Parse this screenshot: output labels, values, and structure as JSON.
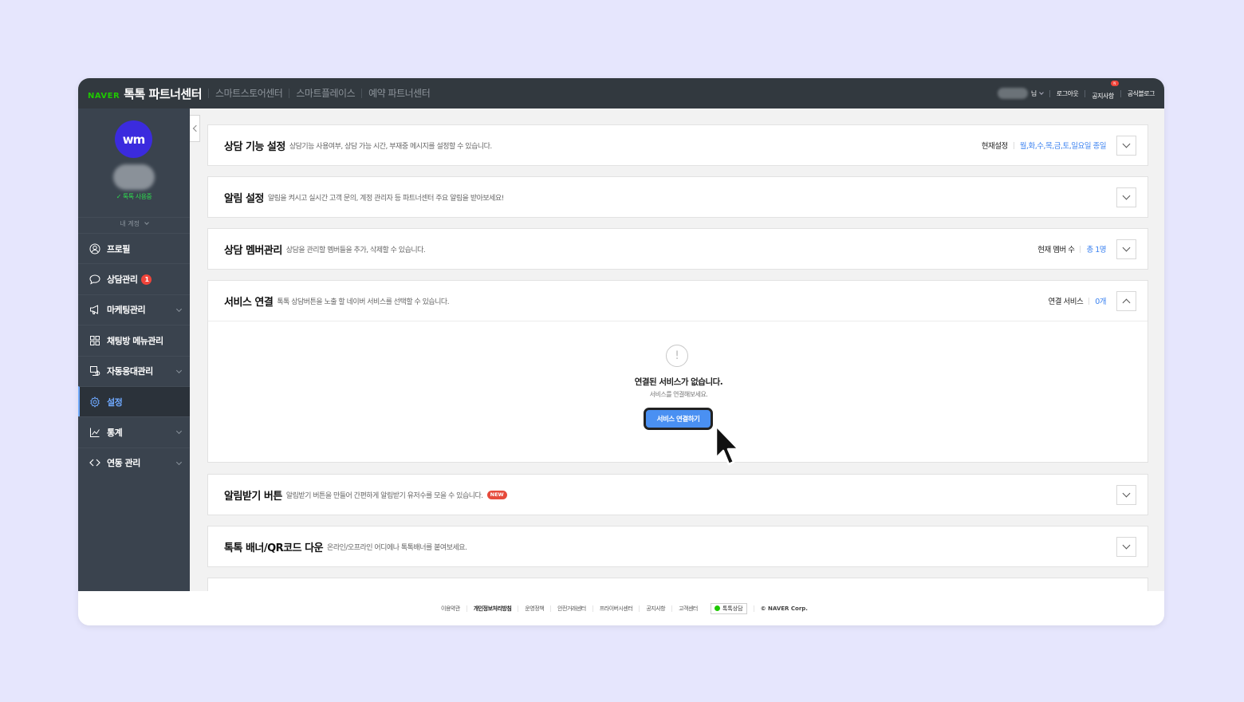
{
  "topbar": {
    "naver": "NAVER",
    "title": "톡톡 파트너센터",
    "nav": [
      "스마트스토어센터",
      "스마트플레이스",
      "예약 파트너센터"
    ],
    "user_suffix": "님",
    "logout": "로그아웃",
    "notice": "공지사항",
    "notice_badge": "N",
    "blog": "공식블로그"
  },
  "sidebar": {
    "avatar_text": "wm",
    "status": "톡톡 사용중",
    "account": "내 계정",
    "items": [
      {
        "label": "프로필",
        "icon": "profile-icon"
      },
      {
        "label": "상담관리",
        "icon": "chat-bubble-icon",
        "badge": "1"
      },
      {
        "label": "마케팅관리",
        "icon": "megaphone-icon"
      },
      {
        "label": "채팅방 메뉴관리",
        "icon": "grid-icon"
      },
      {
        "label": "자동응대관리",
        "icon": "auto-reply-icon"
      },
      {
        "label": "설정",
        "icon": "gear-icon"
      },
      {
        "label": "통계",
        "icon": "chart-icon"
      },
      {
        "label": "연동 관리",
        "icon": "code-icon"
      }
    ]
  },
  "cards": [
    {
      "title": "상담 기능 설정",
      "desc": "상담기능 사용여부, 상담 가능 시간, 부재중 메시지를 설정할 수 있습니다.",
      "right_label": "현재설정",
      "right_value": "월,화,수,목,금,토,일요일 종일"
    },
    {
      "title": "알림 설정",
      "desc": "알림을 켜시고 실시간 고객 문의, 계정 관리자 등 파트너센터 주요 알림을 받아보세요!"
    },
    {
      "title": "상담 멤버관리",
      "desc": "상담을 관리할 멤버들을 추가, 삭제할 수 있습니다.",
      "right_label": "현재 멤버 수",
      "right_value": "총 1명"
    },
    {
      "title": "서비스 연결",
      "desc": "톡톡 상담버튼을 노출 할 네이버 서비스를 선택할 수 있습니다.",
      "right_label": "연결 서비스",
      "right_value": "0개"
    },
    {
      "title": "알림받기 버튼",
      "desc": "알림받기 버튼을 만들어 간편하게 알림받기 유저수를 모을 수 있습니다.",
      "badge": "NEW"
    },
    {
      "title": "톡톡 배너/QR코드 다운",
      "desc": "온라인/오프라인 어디에나 톡톡배너를 붙여보세요."
    }
  ],
  "service_empty": {
    "icon": "!",
    "title": "연결된 서비스가 없습니다.",
    "desc": "서비스를 연결해보세요.",
    "button": "서비스 연결하기"
  },
  "footer": {
    "links": [
      "이용약관",
      "개인정보처리방침",
      "운영정책",
      "안전거래센터",
      "프라이버시센터",
      "공지사항",
      "고객센터"
    ],
    "talk": "톡톡상담",
    "copyright": "© NAVER Corp."
  }
}
